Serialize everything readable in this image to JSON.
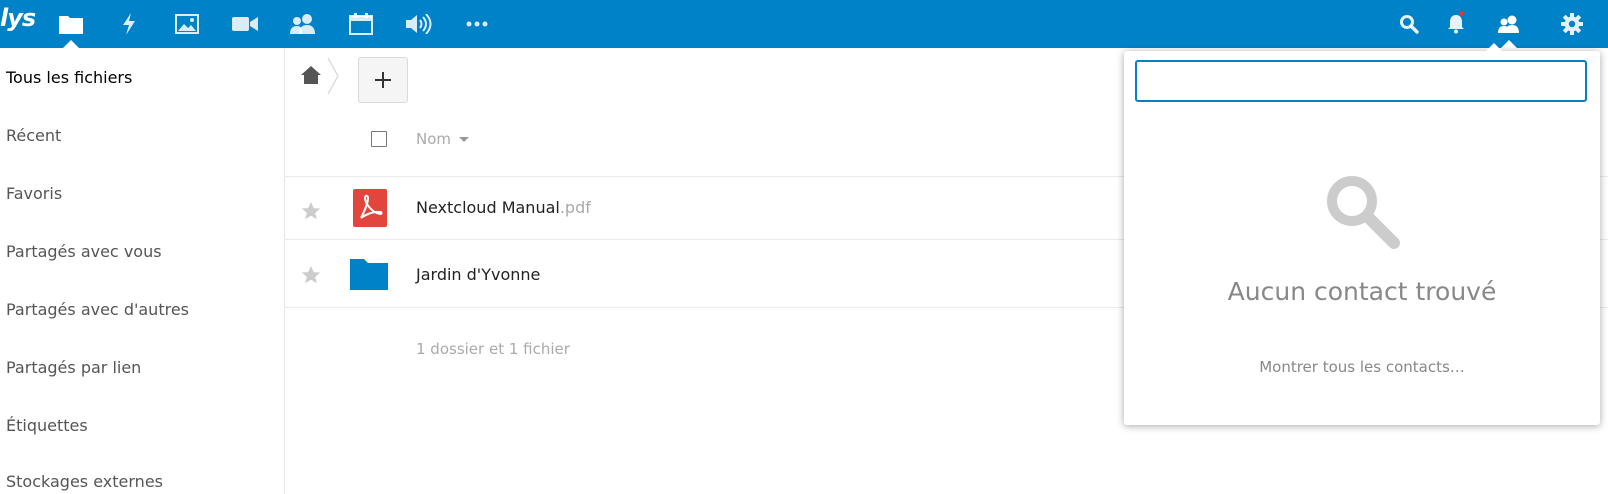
{
  "header": {
    "logo_text": "lys",
    "brand_color": "#0082c9",
    "apps": [
      {
        "name": "files",
        "icon": "folder-icon",
        "active": true
      },
      {
        "name": "activity",
        "icon": "lightning-icon"
      },
      {
        "name": "gallery",
        "icon": "image-icon"
      },
      {
        "name": "video",
        "icon": "video-camera-icon"
      },
      {
        "name": "contacts",
        "icon": "contacts-icon"
      },
      {
        "name": "calendar",
        "icon": "calendar-icon"
      },
      {
        "name": "audio",
        "icon": "speaker-icon"
      },
      {
        "name": "more",
        "icon": "more-icon"
      }
    ],
    "right_icons": [
      "search-icon",
      "bell-icon",
      "contacts-menu-icon",
      "settings-icon"
    ]
  },
  "sidebar": {
    "items": [
      {
        "label": "Tous les fichiers",
        "active": true
      },
      {
        "label": "Récent"
      },
      {
        "label": "Favoris"
      },
      {
        "label": "Partagés avec vous"
      },
      {
        "label": "Partagés avec d'autres"
      },
      {
        "label": "Partagés par lien"
      },
      {
        "label": "Étiquettes"
      },
      {
        "label": "Stockages externes"
      }
    ]
  },
  "files": {
    "new_button": "+",
    "column_name": "Nom",
    "rows": [
      {
        "name": "Nextcloud Manual",
        "ext": ".pdf",
        "type": "pdf",
        "icon_color": "#e2453c"
      },
      {
        "name": "Jardin d'Yvonne",
        "ext": "",
        "type": "folder",
        "icon_color": "#0082c9"
      }
    ],
    "summary": "1 dossier et 1 fichier"
  },
  "contacts_popover": {
    "search_value": "",
    "empty_title": "Aucun contact trouvé",
    "show_all": "Montrer tous les contacts…"
  }
}
